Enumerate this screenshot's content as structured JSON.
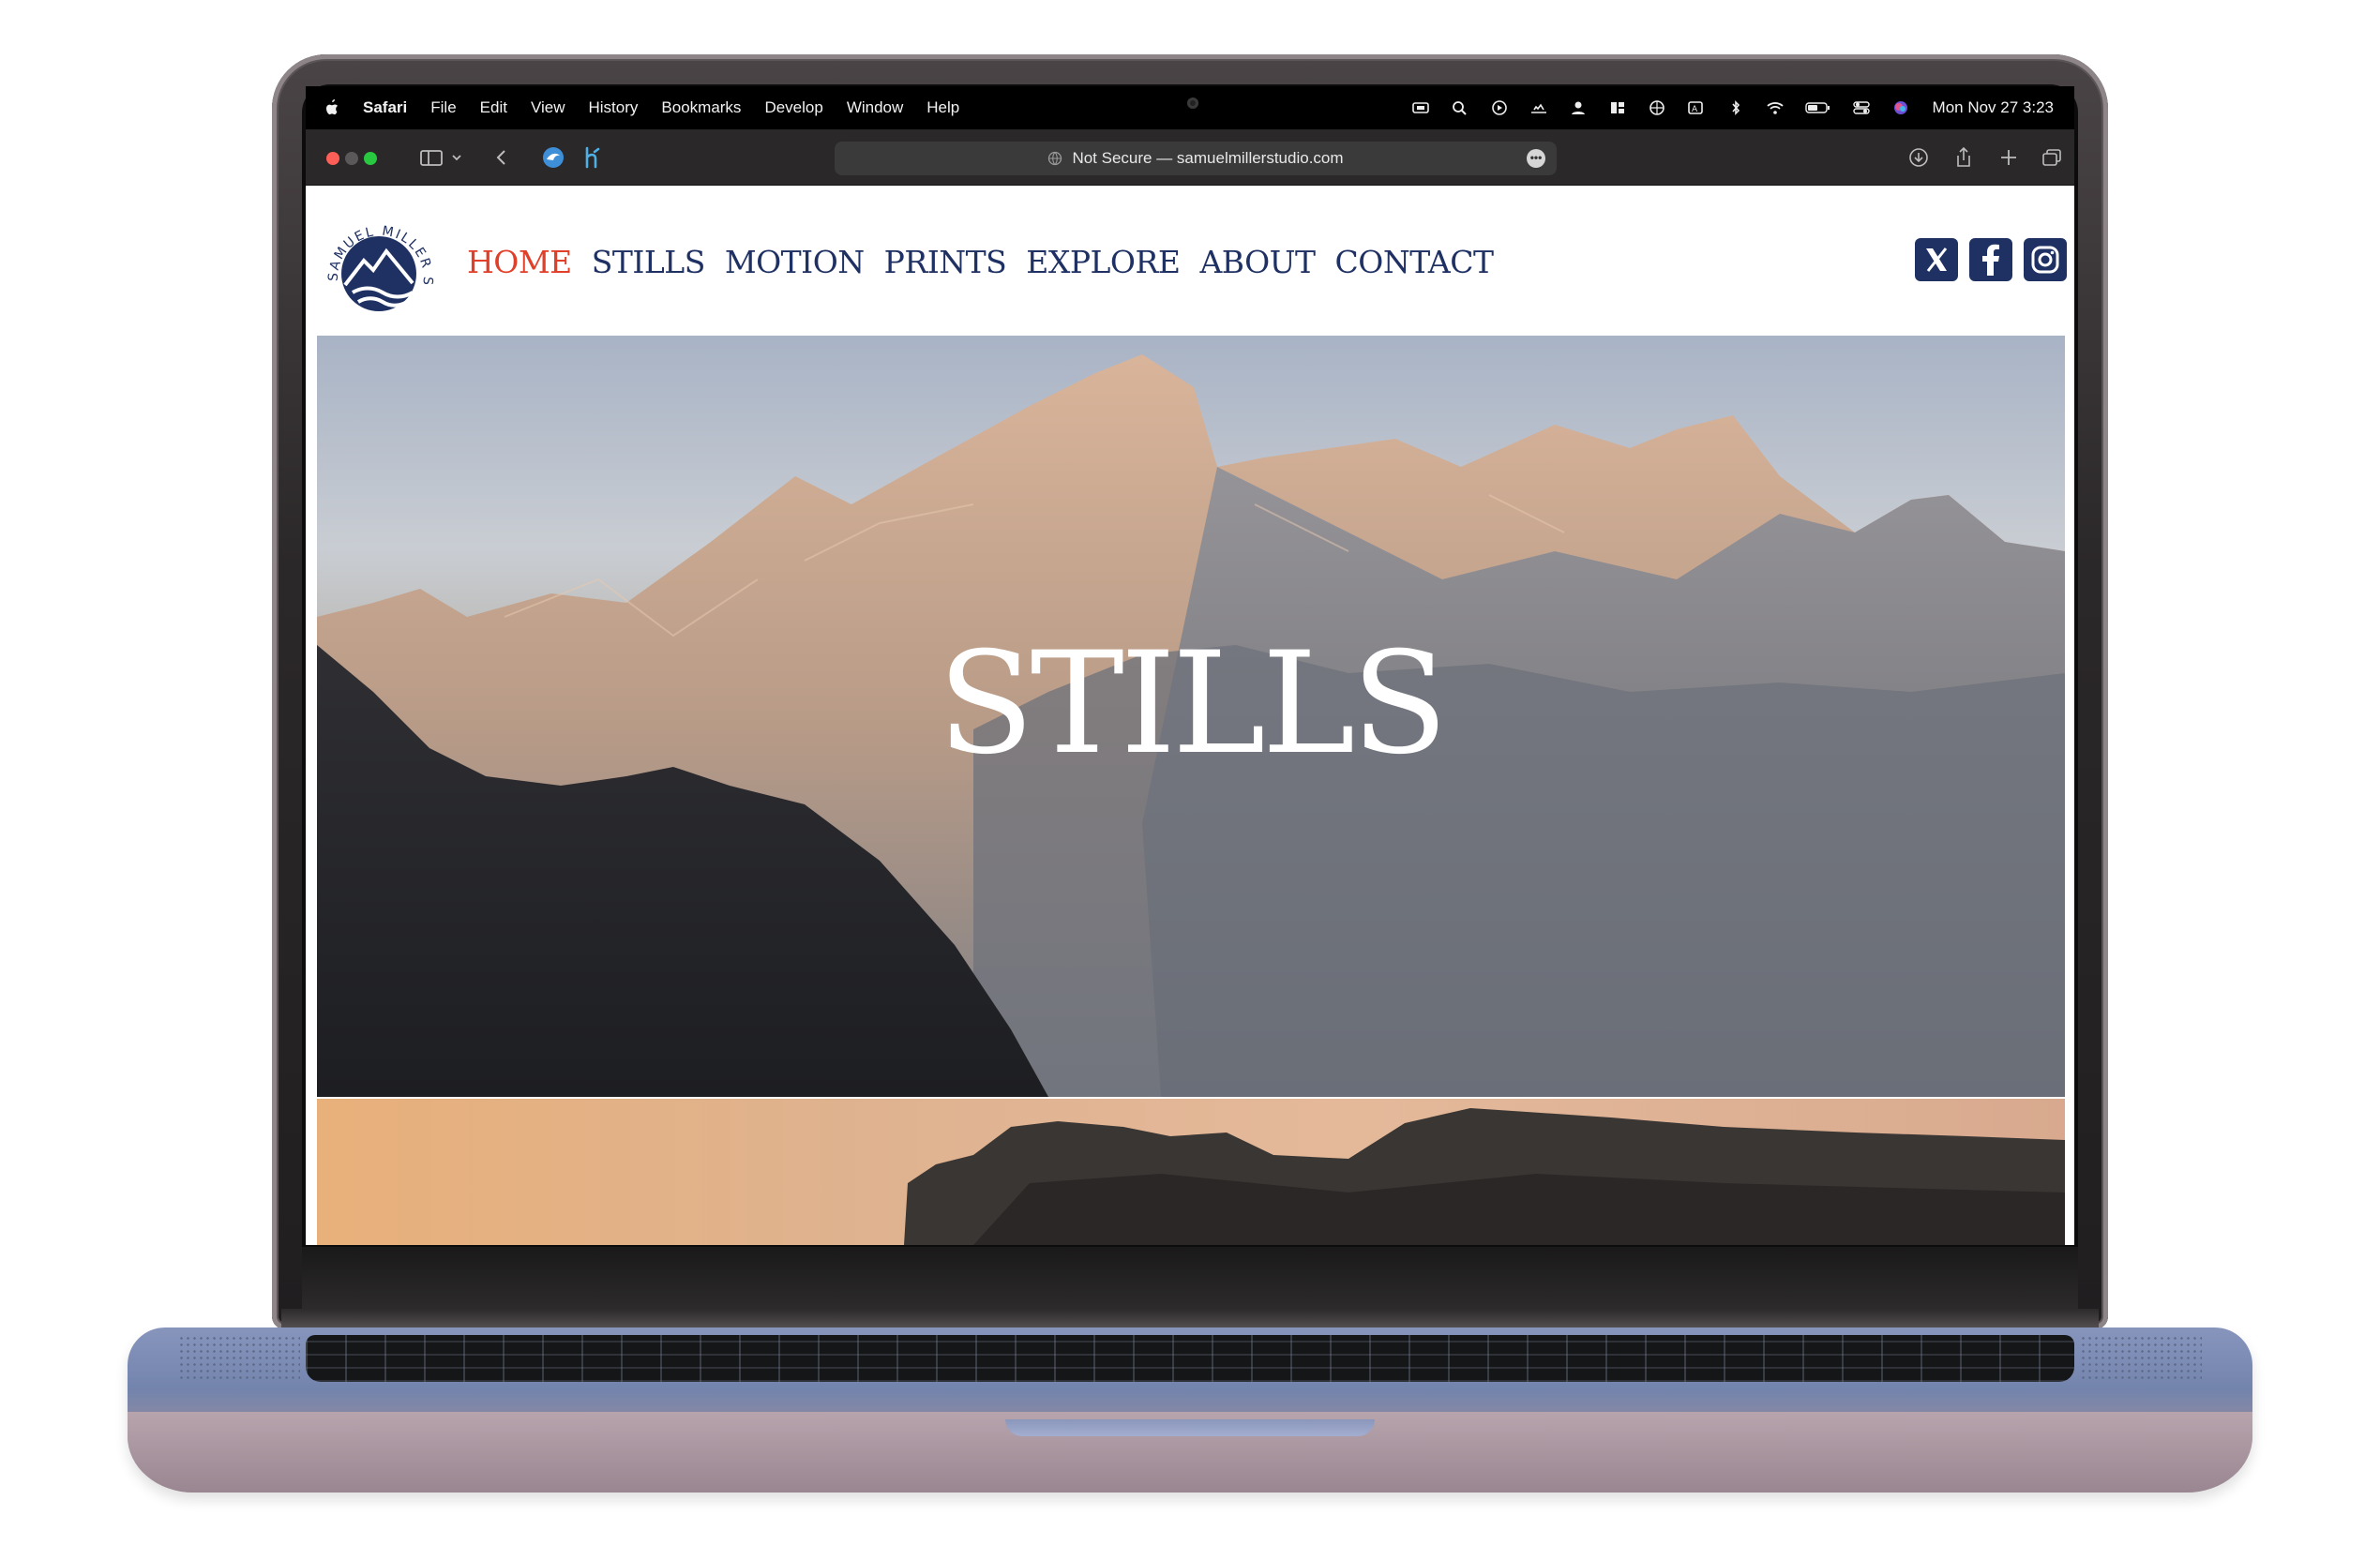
{
  "menubar": {
    "app_name": "Safari",
    "menus": [
      "File",
      "Edit",
      "View",
      "History",
      "Bookmarks",
      "Develop",
      "Window",
      "Help"
    ],
    "clock": "Mon Nov 27  3:23"
  },
  "toolbar": {
    "url_text": "Not Secure — samuelmillerstudio.com"
  },
  "site": {
    "logo_text": "SAMUEL MILLER STUDIO.",
    "nav": [
      "HOME",
      "STILLS",
      "MOTION",
      "PRINTS",
      "EXPLORE",
      "ABOUT",
      "CONTACT"
    ],
    "active_nav": "HOME",
    "social_icons": [
      "x-icon",
      "facebook-icon",
      "instagram-icon"
    ],
    "hero_title": "STILLS"
  },
  "colors": {
    "nav_text": "#1f3163",
    "nav_active": "#e0402a",
    "social_bg": "#1f3163",
    "menubar_bg": "#000000",
    "toolbar_bg": "#2a2828"
  }
}
